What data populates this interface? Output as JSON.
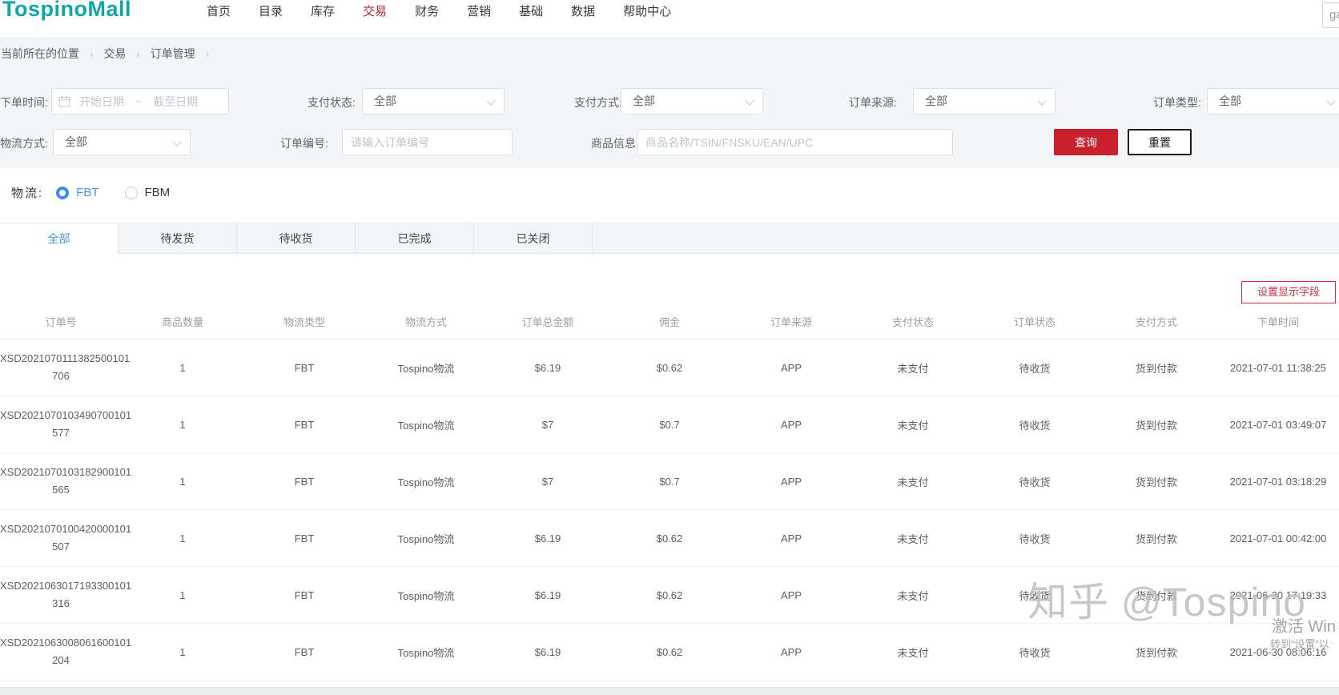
{
  "nav": {
    "logo": "TospinoMall",
    "items": [
      "首页",
      "目录",
      "库存",
      "交易",
      "财务",
      "营销",
      "基础",
      "数据",
      "帮助中心"
    ],
    "active_item": "交易",
    "corner_input": "ga"
  },
  "breadcrumb": {
    "prefix": "您当前所在的位置",
    "separator": "›",
    "items": [
      "交易",
      "订单管理"
    ]
  },
  "filters": {
    "order_time": {
      "label": "下单时间:",
      "start_placeholder": "开始日期",
      "range_separator": "~",
      "end_placeholder": "截至日期"
    },
    "pay_status": {
      "label": "支付状态:",
      "value": "全部"
    },
    "pay_method": {
      "label": "支付方式:",
      "value": "全部"
    },
    "order_source": {
      "label": "订单来源:",
      "value": "全部"
    },
    "order_type": {
      "label": "订单类型:",
      "value": "全部"
    },
    "logistics_method": {
      "label": "物流方式:",
      "value": "全部"
    },
    "order_no": {
      "label": "订单编号:",
      "placeholder": "请输入订单编号"
    },
    "product_info": {
      "label": "商品信息:",
      "placeholder": "商品名称/TSIN/FNSKU/EAN/UPC"
    },
    "search_label": "查询",
    "reset_label": "重置"
  },
  "logistics": {
    "label": "物流:",
    "options": [
      "FBT",
      "FBM"
    ],
    "selected": "FBT"
  },
  "tabs": {
    "items": [
      "全部",
      "待发货",
      "待收货",
      "已完成",
      "已关闭"
    ],
    "active": "全部"
  },
  "table": {
    "settings_button": "设置显示字段",
    "columns": [
      "订单号",
      "商品数量",
      "物流类型",
      "物流方式",
      "订单总金额",
      "佣金",
      "订单来源",
      "支付状态",
      "订单状态",
      "支付方式",
      "下单时间"
    ],
    "rows": [
      {
        "no1": "XSD2021070111382500101",
        "no2": "706",
        "qty": "1",
        "ltype": "FBT",
        "lmethod": "Tospino物流",
        "total": "$6.19",
        "fee": "$0.62",
        "source": "APP",
        "pstatus": "未支付",
        "ostatus": "待收货",
        "pmethod": "货到付款",
        "time": "2021-07-01 11:38:25"
      },
      {
        "no1": "XSD2021070103490700101",
        "no2": "577",
        "qty": "1",
        "ltype": "FBT",
        "lmethod": "Tospino物流",
        "total": "$7",
        "fee": "$0.7",
        "source": "APP",
        "pstatus": "未支付",
        "ostatus": "待收货",
        "pmethod": "货到付款",
        "time": "2021-07-01 03:49:07"
      },
      {
        "no1": "XSD2021070103182900101",
        "no2": "565",
        "qty": "1",
        "ltype": "FBT",
        "lmethod": "Tospino物流",
        "total": "$7",
        "fee": "$0.7",
        "source": "APP",
        "pstatus": "未支付",
        "ostatus": "待收货",
        "pmethod": "货到付款",
        "time": "2021-07-01 03:18:29"
      },
      {
        "no1": "XSD2021070100420000101",
        "no2": "507",
        "qty": "1",
        "ltype": "FBT",
        "lmethod": "Tospino物流",
        "total": "$6.19",
        "fee": "$0.62",
        "source": "APP",
        "pstatus": "未支付",
        "ostatus": "待收货",
        "pmethod": "货到付款",
        "time": "2021-07-01 00:42:00"
      },
      {
        "no1": "XSD2021063017193300101",
        "no2": "316",
        "qty": "1",
        "ltype": "FBT",
        "lmethod": "Tospino物流",
        "total": "$6.19",
        "fee": "$0.62",
        "source": "APP",
        "pstatus": "未支付",
        "ostatus": "待收货",
        "pmethod": "货到付款",
        "time": "2021-06-30 17:19:33"
      },
      {
        "no1": "XSD2021063008061600101",
        "no2": "204",
        "qty": "1",
        "ltype": "FBT",
        "lmethod": "Tospino物流",
        "total": "$6.19",
        "fee": "$0.62",
        "source": "APP",
        "pstatus": "未支付",
        "ostatus": "待收货",
        "pmethod": "货到付款",
        "time": "2021-06-30 08:06:16"
      }
    ]
  },
  "watermark": "知乎 @Tospino",
  "win_activation": {
    "line1": "激活 Win",
    "line2": "转到“设置”以"
  },
  "colors": {
    "brand_teal": "#0fa6a8",
    "nav_active_red": "#a8232e",
    "primary_red": "#c9202e",
    "link_blue": "#4596e6"
  }
}
